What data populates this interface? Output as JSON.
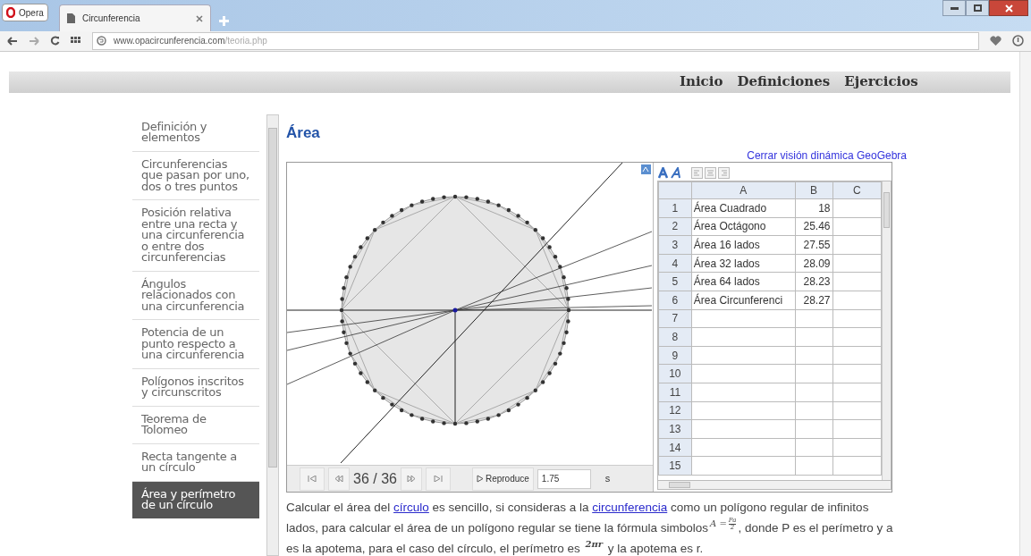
{
  "browser": {
    "menu_button": "Opera",
    "tabs": [
      {
        "title": "Circunferencia",
        "selected": true
      }
    ],
    "url_host": "www.opacircunferencia.com",
    "url_path": "/teoria.php"
  },
  "nav": [
    "Inicio",
    "Definiciones",
    "Ejercicios"
  ],
  "sidebar": {
    "items": [
      {
        "label": "Definición y elementos",
        "selected": false
      },
      {
        "label": "Circunferencias que pasan por uno, dos o tres puntos",
        "selected": false
      },
      {
        "label": "Posición relativa entre una recta y una circunferencia o entre dos circunferencias",
        "selected": false
      },
      {
        "label": "Ángulos relacionados con una circunferencia",
        "selected": false
      },
      {
        "label": "Potencia de un punto respecto a una circunferencia",
        "selected": false
      },
      {
        "label": "Polígonos inscritos y circunscritos",
        "selected": false
      },
      {
        "label": "Teorema de Tolomeo",
        "selected": false
      },
      {
        "label": "Recta tangente a un círculo",
        "selected": false
      },
      {
        "label": "Área y perímetro de un círculo",
        "selected": true
      }
    ]
  },
  "article": {
    "title": "Área",
    "geogebra_link": "Cerrar visión dinámica GeoGebra",
    "applet": {
      "frame": "36 / 36",
      "play_button": "Reproduce",
      "speed": "1.75",
      "speed_unit": "s",
      "spreadsheet": {
        "columns": [
          "A",
          "B",
          "C"
        ],
        "rows": [
          {
            "number": "1",
            "a": "Área Cuadrado",
            "b": "18"
          },
          {
            "number": "2",
            "a": "Área Octágono",
            "b": "25.46"
          },
          {
            "number": "3",
            "a": "Área 16 lados",
            "b": "27.55"
          },
          {
            "number": "4",
            "a": "Área 32 lados",
            "b": "28.09"
          },
          {
            "number": "5",
            "a": "Área 64 lados",
            "b": "28.23"
          },
          {
            "number": "6",
            "a": "Área Circunferenci",
            "b": "28.27"
          },
          {
            "number": "7"
          },
          {
            "number": "8"
          },
          {
            "number": "9"
          },
          {
            "number": "10"
          },
          {
            "number": "11"
          },
          {
            "number": "12"
          },
          {
            "number": "13"
          },
          {
            "number": "14"
          },
          {
            "number": "15"
          }
        ]
      }
    },
    "paragraph": [
      {
        "kind": "text",
        "text": "Calcular el área del "
      },
      {
        "kind": "link",
        "text": "círculo"
      },
      {
        "kind": "text",
        "text": " es sencillo, si consideras a la "
      },
      {
        "kind": "link",
        "text": "circunferencia"
      },
      {
        "kind": "text",
        "text": " como un polígono regular de infinitos lados, para calcular el área de un polígono regular se tiene la fórmula simbolos"
      },
      {
        "kind": "formula",
        "lhs": "A =",
        "numerator": "Pa",
        "denominator": "2"
      },
      {
        "kind": "text",
        "text": ", donde P es el perímetro y a es la apotema, para el caso del círculo, el perímetro es "
      },
      {
        "kind": "math",
        "text": "2πr"
      },
      {
        "kind": "text",
        "text": " y la apotema es r."
      }
    ]
  }
}
